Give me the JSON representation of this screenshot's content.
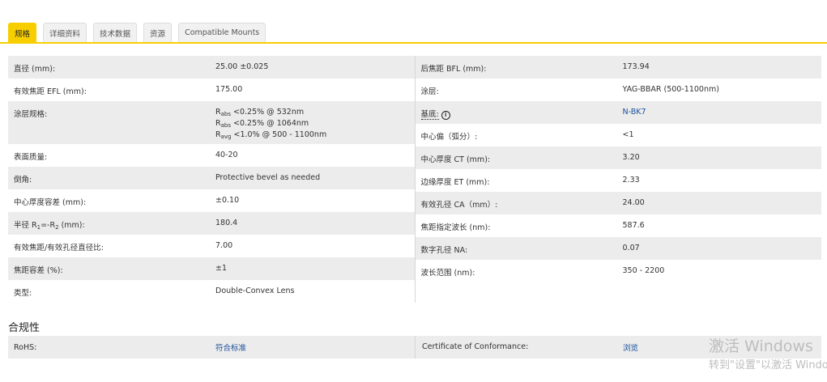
{
  "tabs": [
    {
      "label": "规格",
      "active": true
    },
    {
      "label": "详细资料"
    },
    {
      "label": "技术数据"
    },
    {
      "label": "资源"
    },
    {
      "label": "Compatible Mounts"
    }
  ],
  "specs": {
    "left": [
      {
        "label": "直径 (mm):",
        "value": "25.00 ±0.025"
      },
      {
        "label": "有效焦距 EFL (mm):",
        "value": "175.00"
      },
      {
        "label": "涂层规格:",
        "value_lines": [
          {
            "R": "R",
            "sub": "abs",
            "text": " <0.25% @ 532nm"
          },
          {
            "R": "R",
            "sub": "abs",
            "text": " <0.25% @ 1064nm"
          },
          {
            "R": "R",
            "sub": "avg",
            "text": " <1.0% @ 500 - 1100nm"
          }
        ]
      },
      {
        "label": "表面质量:",
        "value": "40-20"
      },
      {
        "label": "倒角:",
        "value": "Protective bevel as needed"
      },
      {
        "label": "中心厚度容差 (mm):",
        "value": "±0.10"
      },
      {
        "label_parts": [
          "半径 R",
          "1",
          "=-R",
          "2",
          " (mm):"
        ],
        "value": "180.4"
      },
      {
        "label": "有效焦距/有效孔径直径比:",
        "value": "7.00"
      },
      {
        "label": "焦距容差 (%):",
        "value": "±1"
      },
      {
        "label": "类型:",
        "value": "Double-Convex Lens"
      }
    ],
    "right": [
      {
        "label": "后焦距 BFL (mm):",
        "value": "173.94"
      },
      {
        "label": "涂层:",
        "value": "YAG-BBAR (500-1100nm)"
      },
      {
        "label": "基底:",
        "info_icon": "i",
        "value": "N-BK7",
        "link": true
      },
      {
        "label": "中心偏（弧分）:",
        "value": "<1"
      },
      {
        "label": "中心厚度 CT (mm):",
        "value": "3.20"
      },
      {
        "label": "边缘厚度 ET (mm):",
        "value": "2.33"
      },
      {
        "label": "有效孔径 CA（mm）:",
        "value": "24.00"
      },
      {
        "label": "焦距指定波长 (nm):",
        "value": "587.6"
      },
      {
        "label": "数字孔径 NA:",
        "value": "0.07"
      },
      {
        "label": "波长范围 (nm):",
        "value": "350 - 2200"
      }
    ]
  },
  "compliance": {
    "title": "合规性",
    "rohs_label": "RoHS:",
    "rohs_value": "符合标准",
    "coc_label": "Certificate of Conformance:",
    "coc_value": "浏览"
  },
  "watermark": {
    "line1": "激活 Windows",
    "line2": "转到\"设置\"以激活 Windows。"
  },
  "colors": {
    "accent": "#f7cf00",
    "link": "#1a4f9c",
    "row_alt": "#ececec"
  }
}
